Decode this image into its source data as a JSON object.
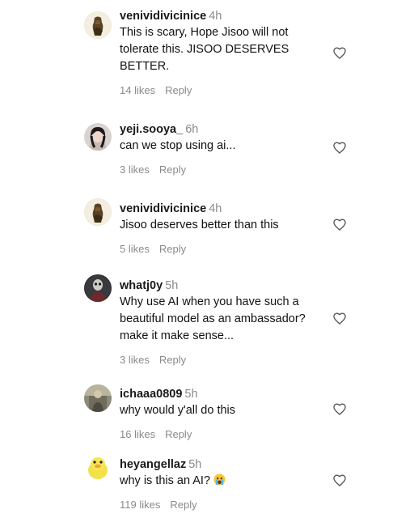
{
  "comments": [
    {
      "username": "venividivicinice",
      "time": "4h",
      "text": "This is scary, Hope Jisoo will not tolerate this. JISOO DESERVES BETTER.",
      "likes": "14 likes",
      "reply": "Reply"
    },
    {
      "username": "yeji.sooya_",
      "time": "6h",
      "text": "can we stop using ai...",
      "likes": "3 likes",
      "reply": "Reply"
    },
    {
      "username": "venividivicinice",
      "time": "4h",
      "text": "Jisoo deserves better than this",
      "likes": "5 likes",
      "reply": "Reply"
    },
    {
      "username": "whatj0y",
      "time": "5h",
      "text": "Why use AI when you have such a beautiful model as an ambassador? make it make sense...",
      "likes": "3 likes",
      "reply": "Reply"
    },
    {
      "username": "ichaaa0809",
      "time": "5h",
      "text": "why would y'all do this",
      "likes": "16 likes",
      "reply": "Reply"
    },
    {
      "username": "heyangellaz",
      "time": "5h",
      "text": "why is this an AI?",
      "likes": "119 likes",
      "reply": "Reply",
      "emoji": "crying-face-emoji"
    }
  ],
  "icons": {
    "like": "heart-outline-icon"
  },
  "colors": {
    "username": "#1a1a1a",
    "secondary_text": "#8a8a8a",
    "background": "#ffffff"
  }
}
